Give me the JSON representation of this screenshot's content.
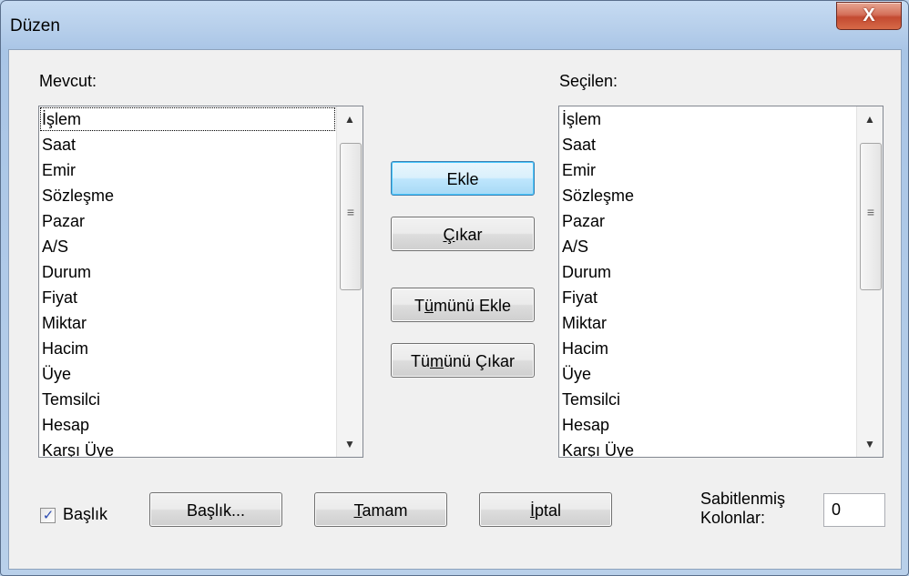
{
  "window": {
    "title": "Düzen",
    "close_glyph": "X"
  },
  "available": {
    "label": "Mevcut:",
    "items": [
      "İşlem",
      "Saat",
      "Emir",
      "Sözleşme",
      "Pazar",
      "A/S",
      "Durum",
      "Fiyat",
      "Miktar",
      "Hacim",
      "Üye",
      "Temsilci",
      "Hesap",
      "Karşı Üye"
    ]
  },
  "selected": {
    "label": "Seçilen:",
    "items": [
      "İşlem",
      "Saat",
      "Emir",
      "Sözleşme",
      "Pazar",
      "A/S",
      "Durum",
      "Fiyat",
      "Miktar",
      "Hacim",
      "Üye",
      "Temsilci",
      "Hesap",
      "Karşı Üye"
    ]
  },
  "scrollbar": {
    "up_glyph": "▲",
    "down_glyph": "▼",
    "grip_glyph": "≡"
  },
  "buttons": {
    "add": "Ekle",
    "remove_key": "Ç",
    "remove_rest": "ıkar",
    "add_all_pre": "T",
    "add_all_key": "ü",
    "add_all_rest": "münü Ekle",
    "remove_all_pre": "Tü",
    "remove_all_key": "m",
    "remove_all_rest": "ünü Çıkar",
    "header_dialog": "Başlık...",
    "ok_key": "T",
    "ok_rest": "amam",
    "cancel_key": "İ",
    "cancel_rest": "ptal"
  },
  "header_checkbox": {
    "label": "Başlık",
    "checked": true,
    "check_glyph": "✓"
  },
  "fixed_columns": {
    "label_line1": "Sabitlenmiş",
    "label_line2": "Kolonlar:",
    "value": "0"
  },
  "colors": {
    "default_button_border": "#3c7fb1",
    "close_button": "#c34a31",
    "dialog_background": "#f0f0f0"
  }
}
